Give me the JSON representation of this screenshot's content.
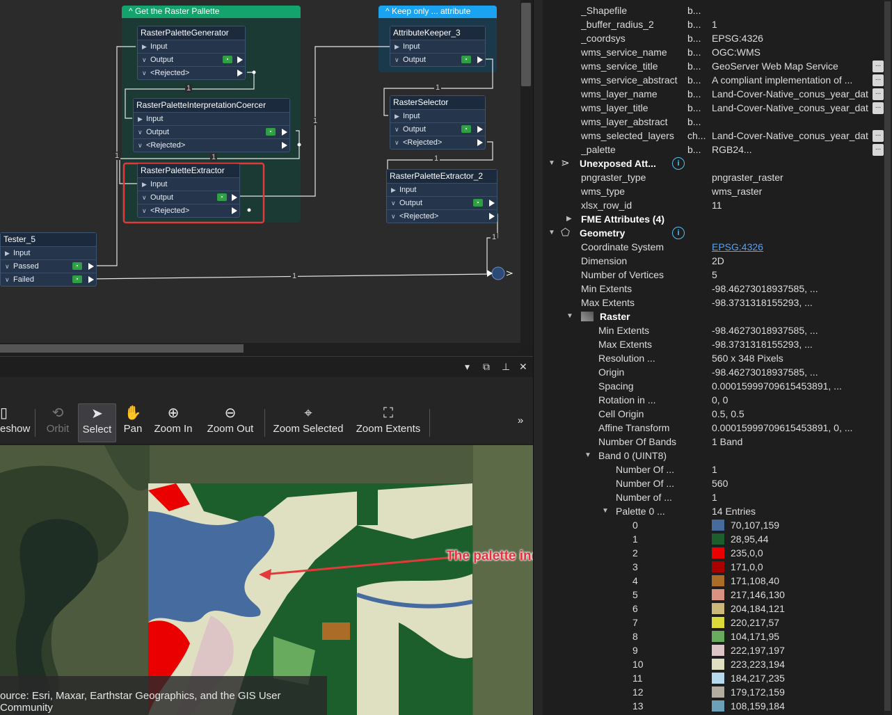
{
  "workspace": {
    "bookmarks": [
      {
        "title": "Get the Raster Pallette",
        "color": "#12a46c",
        "body": "#1a3a33"
      },
      {
        "title": "Keep only ... attribute",
        "color": "#1aa3f0",
        "body": "#1a3a4b"
      }
    ],
    "transformers": {
      "generator": {
        "title": "RasterPaletteGenerator",
        "ports": [
          "Input",
          "Output",
          "<Rejected>"
        ]
      },
      "coercer": {
        "title": "RasterPaletteInterpretationCoercer",
        "ports": [
          "Input",
          "Output",
          "<Rejected>"
        ]
      },
      "extractor": {
        "title": "RasterPaletteExtractor",
        "ports": [
          "Input",
          "Output",
          "<Rejected>"
        ]
      },
      "keeper": {
        "title": "AttributeKeeper_3",
        "ports": [
          "Input",
          "Output"
        ]
      },
      "selector": {
        "title": "RasterSelector",
        "ports": [
          "Input",
          "Output",
          "<Rejected>"
        ]
      },
      "extractor2": {
        "title": "RasterPaletteExtractor_2",
        "ports": [
          "Input",
          "Output",
          "<Rejected>"
        ]
      },
      "tester": {
        "title": "Tester_5",
        "ports": [
          "Input",
          "Passed",
          "Failed"
        ]
      }
    },
    "wire_labels": [
      "1",
      "1",
      "1",
      "1",
      "1",
      "1",
      "1",
      "1"
    ]
  },
  "viewer": {
    "window_controls": [
      "▾",
      "⧉",
      "⊥",
      "✕"
    ],
    "tools": [
      {
        "label": "eshow",
        "icon": "slideshow-icon"
      },
      {
        "label": "Orbit",
        "icon": "orbit-icon"
      },
      {
        "label": "Select",
        "icon": "cursor-icon"
      },
      {
        "label": "Pan",
        "icon": "hand-icon"
      },
      {
        "label": "Zoom In",
        "icon": "zoom-in-icon"
      },
      {
        "label": "Zoom Out",
        "icon": "zoom-out-icon"
      },
      {
        "label": "Zoom Selected",
        "icon": "zoom-selected-icon"
      },
      {
        "label": "Zoom Extents",
        "icon": "zoom-extents-icon"
      }
    ],
    "overflow": "»",
    "credit": "ource: Esri, Maxar, Earthstar Geographics, and the GIS User Community",
    "annotation": "The palette index is different"
  },
  "properties": {
    "rows": [
      {
        "k": "_Shapefile",
        "t": "b...",
        "v": ""
      },
      {
        "k": "_buffer_radius_2",
        "t": "b...",
        "v": "1"
      },
      {
        "k": "_coordsys",
        "t": "b...",
        "v": "EPSG:4326"
      },
      {
        "k": "wms_service_name",
        "t": "b...",
        "v": "OGC:WMS"
      },
      {
        "k": "wms_service_title",
        "t": "b...",
        "v": "GeoServer Web Map Service",
        "more": true
      },
      {
        "k": "wms_service_abstract",
        "t": "b...",
        "v": "A compliant implementation of ...",
        "more": true
      },
      {
        "k": "wms_layer_name",
        "t": "b...",
        "v": "Land-Cover-Native_conus_year_dat",
        "more": true
      },
      {
        "k": "wms_layer_title",
        "t": "b...",
        "v": "Land-Cover-Native_conus_year_dat",
        "more": true
      },
      {
        "k": "wms_layer_abstract",
        "t": "b...",
        "v": ""
      },
      {
        "k": "wms_selected_layers",
        "t": "ch...",
        "v": "Land-Cover-Native_conus_year_dat",
        "more": true
      },
      {
        "k": "_palette",
        "t": "b...",
        "v": "RGB24...",
        "more": true
      }
    ],
    "unexposed_title": "Unexposed Att...",
    "unexposed": [
      {
        "k": "pngraster_type",
        "v": "pngraster_raster"
      },
      {
        "k": "wms_type",
        "v": "wms_raster"
      },
      {
        "k": "xlsx_row_id",
        "v": "11"
      }
    ],
    "fme_attributes": "FME Attributes (4)",
    "geometry_title": "Geometry",
    "geometry": [
      {
        "k": "Coordinate System",
        "v": "EPSG:4326",
        "link": true
      },
      {
        "k": "Dimension",
        "v": "2D"
      },
      {
        "k": "Number of Vertices",
        "v": "5"
      },
      {
        "k": "Min Extents",
        "v": "-98.46273018937585, ..."
      },
      {
        "k": "Max Extents",
        "v": "-98.3731318155293, ..."
      }
    ],
    "raster_title": "Raster",
    "raster": [
      {
        "k": "Min Extents",
        "v": "-98.46273018937585, ..."
      },
      {
        "k": "Max Extents",
        "v": "-98.3731318155293, ..."
      },
      {
        "k": "Resolution ...",
        "v": "560 x 348 Pixels"
      },
      {
        "k": "Origin",
        "v": "-98.46273018937585, ..."
      },
      {
        "k": "Spacing",
        "v": "0.00015999709615453891, ..."
      },
      {
        "k": "Rotation in ...",
        "v": "0, 0"
      },
      {
        "k": "Cell Origin",
        "v": "0.5, 0.5"
      },
      {
        "k": "Affine Transform",
        "v": "0.00015999709615453891, 0, ..."
      },
      {
        "k": "Number Of Bands",
        "v": "1 Band"
      }
    ],
    "band_title": "Band 0 (UINT8)",
    "band": [
      {
        "k": "Number Of ...",
        "v": "1"
      },
      {
        "k": "Number Of ...",
        "v": "560"
      },
      {
        "k": "Number of ...",
        "v": "1"
      }
    ],
    "palette_title": "Palette 0 ...",
    "palette_entries": "14 Entries",
    "palette": [
      {
        "i": "0",
        "v": "70,107,159",
        "c": "#466b9f"
      },
      {
        "i": "1",
        "v": "28,95,44",
        "c": "#1c5f2c"
      },
      {
        "i": "2",
        "v": "235,0,0",
        "c": "#eb0000"
      },
      {
        "i": "3",
        "v": "171,0,0",
        "c": "#ab0000"
      },
      {
        "i": "4",
        "v": "171,108,40",
        "c": "#ab6c28"
      },
      {
        "i": "5",
        "v": "217,146,130",
        "c": "#d99282"
      },
      {
        "i": "6",
        "v": "204,184,121",
        "c": "#ccb879"
      },
      {
        "i": "7",
        "v": "220,217,57",
        "c": "#dcd939"
      },
      {
        "i": "8",
        "v": "104,171,95",
        "c": "#68ab5f"
      },
      {
        "i": "9",
        "v": "222,197,197",
        "c": "#dec5c5"
      },
      {
        "i": "10",
        "v": "223,223,194",
        "c": "#dfdfc2"
      },
      {
        "i": "11",
        "v": "184,217,235",
        "c": "#b8d9eb"
      },
      {
        "i": "12",
        "v": "179,172,159",
        "c": "#b3ac9f"
      },
      {
        "i": "13",
        "v": "108,159,184",
        "c": "#6c9fb8"
      }
    ]
  }
}
